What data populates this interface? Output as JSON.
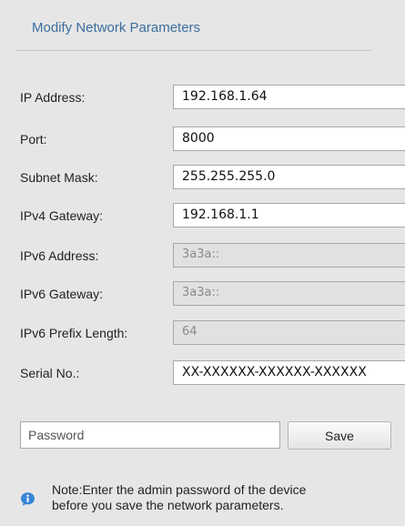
{
  "section": {
    "title": "Modify Network Parameters"
  },
  "fields": {
    "ip_address": {
      "label": "IP Address:",
      "value": "192.168.1.64"
    },
    "port": {
      "label": "Port:",
      "value": "8000"
    },
    "subnet_mask": {
      "label": "Subnet Mask:",
      "value": "255.255.255.0"
    },
    "ipv4_gateway": {
      "label": "IPv4 Gateway:",
      "value": "192.168.1.1"
    },
    "ipv6_address": {
      "label": "IPv6 Address:",
      "value": "3a3a::"
    },
    "ipv6_gateway": {
      "label": "IPv6 Gateway:",
      "value": "3a3a::"
    },
    "ipv6_prefix_length": {
      "label": "IPv6 Prefix Length:",
      "value": "64"
    },
    "serial_no": {
      "label": "Serial No.:",
      "value": "XX-XXXXXX-XXXXXX-XXXXXX"
    }
  },
  "password": {
    "placeholder": "Password"
  },
  "save_label": "Save",
  "note": {
    "line1": "Note:Enter the admin password of the device",
    "line2": "before you save the network parameters."
  },
  "colors": {
    "title": "#3c6e9e",
    "info_icon": "#3a86d4"
  },
  "icons": {
    "note": "info-icon"
  }
}
